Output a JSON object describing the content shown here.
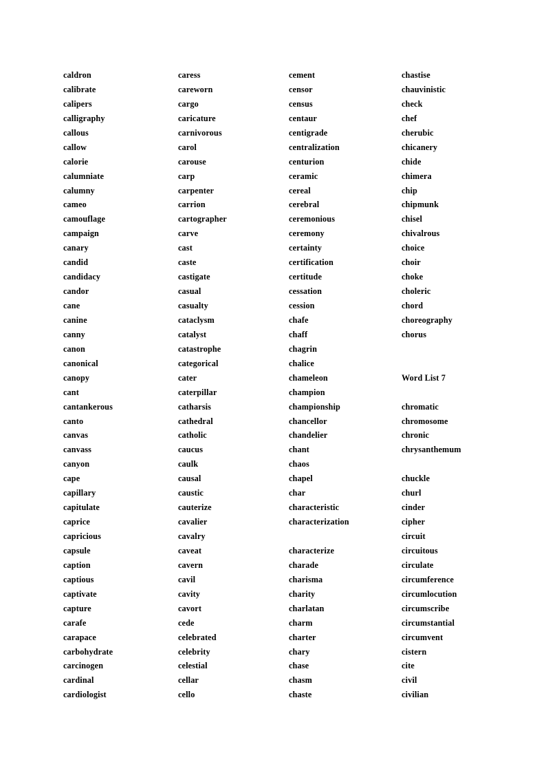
{
  "document": {
    "type": "vocabulary-word-list",
    "heading_text": "Word List 7",
    "columns_count": 4,
    "rows_count": 43,
    "colors": {
      "page_background": "#ffffff",
      "text": "#000000"
    }
  },
  "columns": [
    {
      "index": 1,
      "entries": [
        "caldron",
        "calibrate",
        "calipers",
        "calligraphy",
        "callous",
        "callow",
        "calorie",
        "calumniate",
        "calumny",
        "cameo",
        "camouflage",
        "campaign",
        "canary",
        "candid",
        "candidacy",
        "candor",
        "cane",
        "canine",
        "canny",
        "canon",
        "canonical",
        "canopy",
        "cant",
        "cantankerous",
        "canto",
        "canvas",
        "canvass",
        "canyon",
        "cape",
        "capillary",
        "capitulate",
        "caprice",
        "capricious",
        "capsule",
        "caption",
        "captious",
        "captivate",
        "capture",
        "carafe",
        "carapace",
        "carbohydrate",
        "carcinogen",
        "cardinal",
        "cardiologist"
      ]
    },
    {
      "index": 2,
      "entries": [
        "caress",
        "careworn",
        "cargo",
        "caricature",
        "carnivorous",
        "carol",
        "carouse",
        "carp",
        "carpenter",
        "carrion",
        "cartographer",
        "carve",
        "cast",
        "caste",
        "castigate",
        "casual",
        "casualty",
        "cataclysm",
        "catalyst",
        "catastrophe",
        "categorical",
        "cater",
        "caterpillar",
        "catharsis",
        "cathedral",
        "catholic",
        "caucus",
        "caulk",
        "causal",
        "caustic",
        "cauterize",
        "cavalier",
        "cavalry",
        "caveat",
        "cavern",
        "cavil",
        "cavity",
        "cavort",
        "cede",
        "celebrated",
        "celebrity",
        "celestial",
        "cellar",
        "cello"
      ]
    },
    {
      "index": 3,
      "entries": [
        "cement",
        "censor",
        "census",
        "centaur",
        "centigrade",
        "centralization",
        "centurion",
        "ceramic",
        "cereal",
        "cerebral",
        "ceremonious",
        "ceremony",
        "certainty",
        "certification",
        "certitude",
        "cessation",
        "cession",
        "chafe",
        "chaff",
        "chagrin",
        "chalice",
        "chameleon",
        "champion",
        "championship",
        "chancellor",
        "chandelier",
        "chant",
        "chaos",
        "chapel",
        "char",
        "characteristic",
        "characterization",
        "",
        "characterize",
        "charade",
        "charisma",
        "charity",
        "charlatan",
        "charm",
        "charter",
        "chary",
        "chase",
        "chasm",
        "chaste"
      ]
    },
    {
      "index": 4,
      "entries": [
        "chastise",
        "chauvinistic",
        "check",
        "chef",
        "cherubic",
        "chicanery",
        "chide",
        "chimera",
        "chip",
        "chipmunk",
        "chisel",
        "chivalrous",
        "choice",
        "choir",
        "choke",
        "choleric",
        "chord",
        "choreography",
        "chorus",
        "",
        "",
        "Word List 7",
        "",
        "chromatic",
        "chromosome",
        "chronic",
        "chrysanthemum",
        "",
        "chuckle",
        "churl",
        "cinder",
        "cipher",
        "circuit",
        "circuitous",
        "circulate",
        "circumference",
        "circumlocution",
        "circumscribe",
        "circumstantial",
        "circumvent",
        "cistern",
        "cite",
        "civil",
        "civilian"
      ]
    }
  ]
}
